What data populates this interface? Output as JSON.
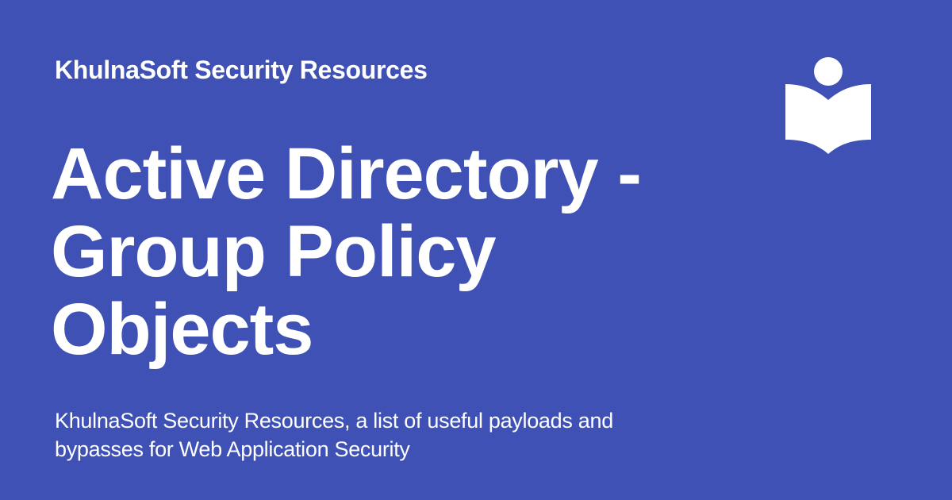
{
  "card": {
    "background_color": "#3f51b5",
    "text_color": "#ffffff",
    "site_name": "KhulnaSoft Security Resources",
    "title_lines": [
      "Active Directory -",
      "Group Policy",
      "Objects"
    ],
    "description_lines": [
      "KhulnaSoft Security Resources, a list of useful payloads and",
      "bypasses for Web Application Security"
    ],
    "logo_icon": "book-reader-icon"
  }
}
